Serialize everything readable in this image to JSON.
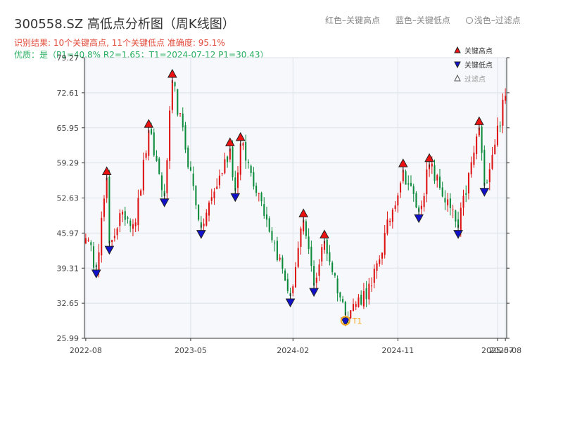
{
  "header": {
    "title": "300558.SZ 高低点分析图（周K线图）",
    "legend_red": "红色–关键高点",
    "legend_blue": "蓝色–关键低点",
    "legend_light": "浅色–过滤点"
  },
  "info": {
    "line1": "识别结果: 10个关键高点, 11个关键低点  准确度: 95.1%",
    "line2": "优质：是（P1=40.8%  R2=1.65；T1=2024-07-12 P1=30.43）"
  },
  "colors": {
    "up": "#dd1111",
    "down": "#0a8a3a",
    "high_marker": "#ee1111",
    "low_marker": "#1111cc",
    "highlight": "#f5a623",
    "plot_bg": "#f6f8fb"
  },
  "chart_data": {
    "type": "candlestick",
    "y_ticks": [
      "25.99",
      "32.65",
      "39.31",
      "45.97",
      "52.63",
      "59.29",
      "65.95",
      "72.61",
      "79.27"
    ],
    "ylim": [
      25.99,
      79.27
    ],
    "x_ticks": [
      {
        "label": "2022-08",
        "index": 0
      },
      {
        "label": "2023-05",
        "index": 40
      },
      {
        "label": "2024-02",
        "index": 79
      },
      {
        "label": "2024-11",
        "index": 119
      },
      {
        "label": "2025-07",
        "index": 157
      },
      {
        "label": "2025-08",
        "index": 160
      }
    ],
    "legend": [
      {
        "label": "关键高点",
        "marker": "triangle-up",
        "color": "#ee1111"
      },
      {
        "label": "关键低点",
        "marker": "triangle-down",
        "color": "#1111cc"
      },
      {
        "label": "过滤点",
        "marker": "triangle-up-hollow",
        "color": "#999999"
      }
    ],
    "anchors": [
      [
        0,
        45
      ],
      [
        4,
        39.5
      ],
      [
        8,
        56.5
      ],
      [
        9,
        44
      ],
      [
        14,
        50
      ],
      [
        19,
        48
      ],
      [
        24,
        65.5
      ],
      [
        30,
        53
      ],
      [
        33,
        75
      ],
      [
        44,
        47
      ],
      [
        55,
        62
      ],
      [
        57,
        54
      ],
      [
        59,
        63
      ],
      [
        67,
        52
      ],
      [
        78,
        34
      ],
      [
        83,
        48.5
      ],
      [
        87,
        36
      ],
      [
        91,
        44.5
      ],
      [
        99,
        30.4
      ],
      [
        109,
        36
      ],
      [
        121,
        58
      ],
      [
        127,
        50
      ],
      [
        131,
        59
      ],
      [
        142,
        47
      ],
      [
        150,
        66
      ],
      [
        152,
        55
      ],
      [
        160,
        72
      ]
    ],
    "key_highs": [
      {
        "i": 8,
        "v": 56.5
      },
      {
        "i": 24,
        "v": 65.5
      },
      {
        "i": 33,
        "v": 75.0
      },
      {
        "i": 55,
        "v": 62.0
      },
      {
        "i": 59,
        "v": 63.0
      },
      {
        "i": 83,
        "v": 48.5
      },
      {
        "i": 91,
        "v": 44.5
      },
      {
        "i": 121,
        "v": 58.0
      },
      {
        "i": 131,
        "v": 59.0
      },
      {
        "i": 150,
        "v": 66.0
      }
    ],
    "key_lows": [
      {
        "i": 4,
        "v": 39.5
      },
      {
        "i": 9,
        "v": 44.0
      },
      {
        "i": 30,
        "v": 53.0
      },
      {
        "i": 44,
        "v": 47.0
      },
      {
        "i": 57,
        "v": 54.0
      },
      {
        "i": 78,
        "v": 34.0
      },
      {
        "i": 87,
        "v": 36.0
      },
      {
        "i": 99,
        "v": 30.4
      },
      {
        "i": 127,
        "v": 50.0
      },
      {
        "i": 142,
        "v": 47.0
      },
      {
        "i": 152,
        "v": 55.0
      }
    ],
    "t1": {
      "i": 99,
      "v": 30.4,
      "label": "T1"
    }
  }
}
